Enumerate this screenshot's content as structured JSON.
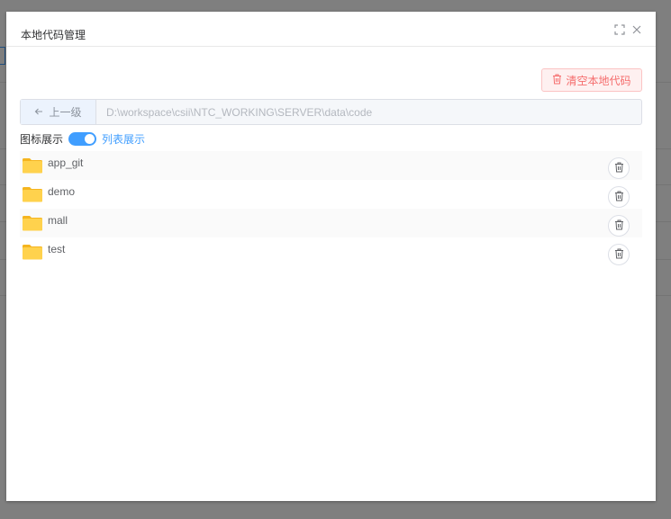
{
  "dialog": {
    "title": "本地代码管理",
    "clear_button_label": "清空本地代码",
    "up_button_label": "上一级",
    "path_value": "D:\\workspace\\csii\\NTC_WORKING\\SERVER\\data\\code",
    "toggle_left_label": "图标展示",
    "toggle_right_label": "列表展示",
    "toggle_on": true
  },
  "files": [
    {
      "name": "app_git",
      "icon": "folder-icon"
    },
    {
      "name": "demo",
      "icon": "folder-icon"
    },
    {
      "name": "mall",
      "icon": "folder-icon"
    },
    {
      "name": "test",
      "icon": "folder-icon"
    }
  ],
  "colors": {
    "primary": "#409eff",
    "danger": "#f56c6c",
    "folder": "#ffc940"
  }
}
